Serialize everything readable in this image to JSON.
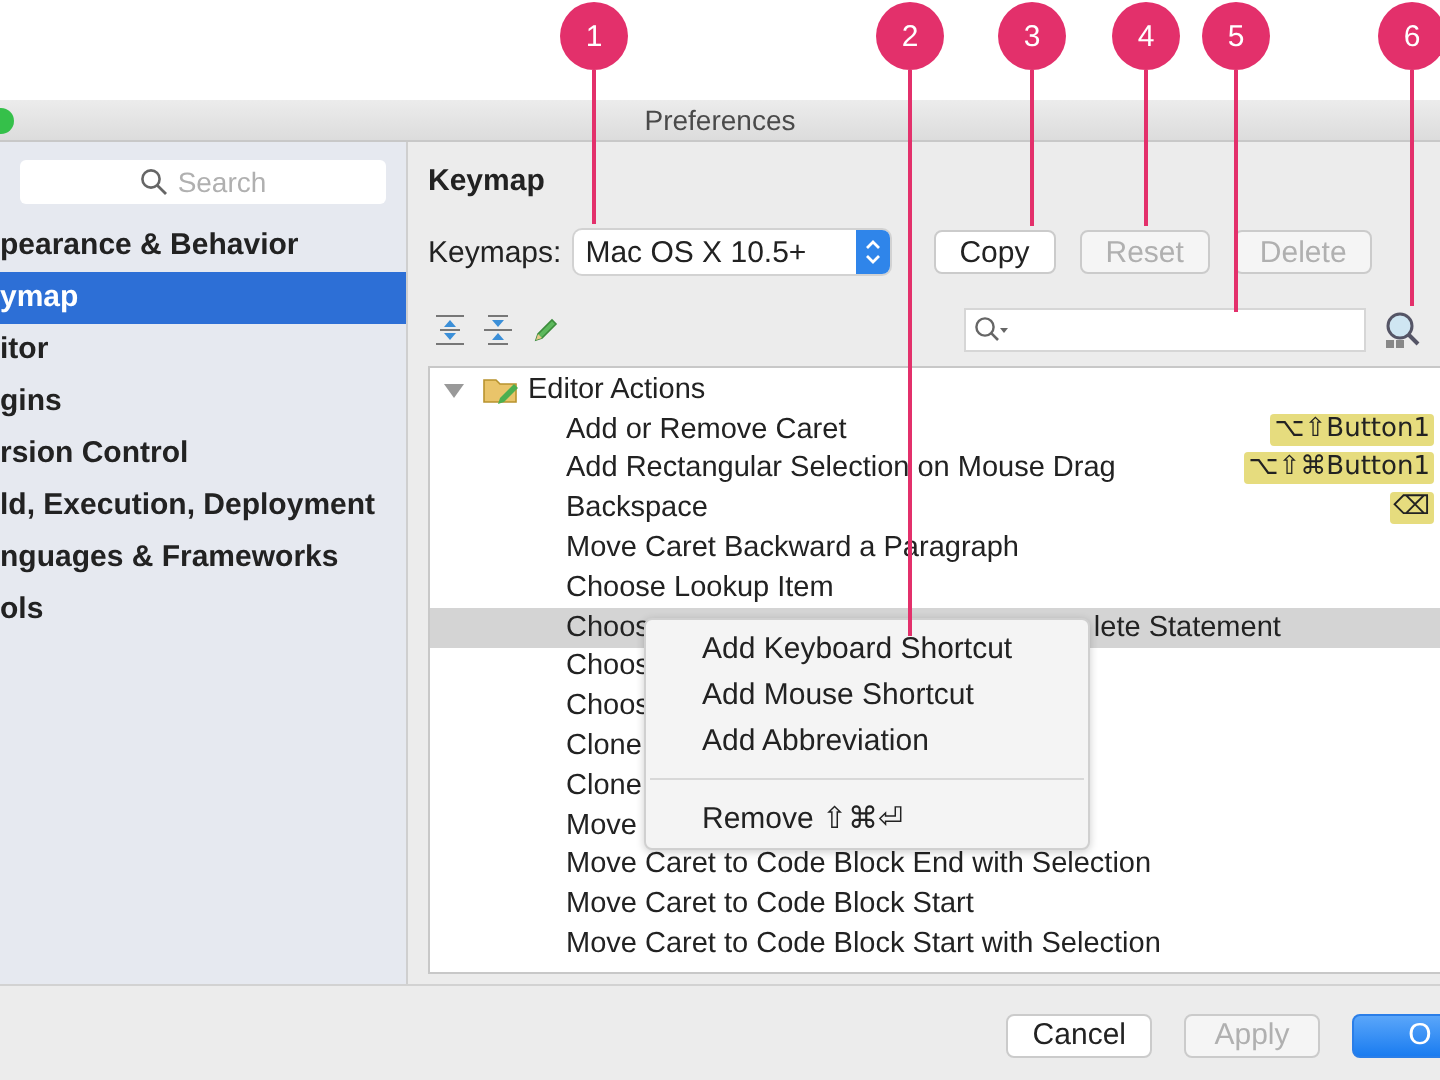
{
  "callouts": [
    {
      "number": "1"
    },
    {
      "number": "2"
    },
    {
      "number": "3"
    },
    {
      "number": "4"
    },
    {
      "number": "5"
    },
    {
      "number": "6"
    }
  ],
  "window": {
    "title": "Preferences"
  },
  "sidebar": {
    "search": {
      "placeholder": "Search"
    },
    "items": [
      {
        "label": "pearance & Behavior",
        "selected": false
      },
      {
        "label": "ymap",
        "selected": true
      },
      {
        "label": "itor",
        "selected": false
      },
      {
        "label": "gins",
        "selected": false
      },
      {
        "label": "rsion Control",
        "selected": false
      },
      {
        "label": "ld, Execution, Deployment",
        "selected": false
      },
      {
        "label": "nguages & Frameworks",
        "selected": false
      },
      {
        "label": "ols",
        "selected": false
      }
    ]
  },
  "panel": {
    "title": "Keymap",
    "keymaps_label": "Keymaps:",
    "keymap_select": {
      "value": "Mac OS X 10.5+"
    },
    "buttons": [
      {
        "label": "Copy",
        "disabled": false
      },
      {
        "label": "Reset",
        "disabled": true
      },
      {
        "label": "Delete",
        "disabled": true
      }
    ]
  },
  "tree": {
    "group": {
      "label": "Editor Actions",
      "expanded": true,
      "children": [
        {
          "parts": [
            "Add or Remove Caret"
          ],
          "shortcut": "⌥⇧Button1",
          "selected": false
        },
        {
          "parts": [
            "Add Rectangular Selection on Mouse Drag"
          ],
          "shortcut": "⌥⇧⌘Button1",
          "selected": false
        },
        {
          "parts": [
            "Backspace"
          ],
          "shortcut": "⌫",
          "selected": false
        },
        {
          "parts": [
            "Move Caret Backward a Paragraph"
          ],
          "selected": false
        },
        {
          "parts": [
            "Choose Lookup Item"
          ],
          "selected": false
        },
        {
          "parts": [
            "Choos",
            "lete Statement"
          ],
          "selected": true
        },
        {
          "parts": [
            "Choos"
          ],
          "selected": false
        },
        {
          "parts": [
            "Choos"
          ],
          "selected": false
        },
        {
          "parts": [
            "Clone"
          ],
          "selected": false
        },
        {
          "parts": [
            "Clone"
          ],
          "selected": false
        },
        {
          "parts": [
            "Move"
          ],
          "selected": false
        },
        {
          "parts": [
            "Move Caret to Code Block End with Selection"
          ],
          "selected": false
        },
        {
          "parts": [
            "Move Caret to Code Block Start"
          ],
          "selected": false
        },
        {
          "parts": [
            "Move Caret to Code Block Start with Selection"
          ],
          "selected": false
        }
      ]
    }
  },
  "context_menu": {
    "items": [
      {
        "kind": "item",
        "label": "Add Keyboard Shortcut"
      },
      {
        "kind": "item",
        "label": "Add Mouse Shortcut"
      },
      {
        "kind": "item",
        "label": "Add Abbreviation"
      },
      {
        "kind": "separator"
      },
      {
        "kind": "item",
        "label": "Remove",
        "shortcut": "⇧⌘⏎"
      }
    ]
  },
  "footer": {
    "buttons": [
      {
        "label": "Cancel",
        "disabled": false,
        "default": false
      },
      {
        "label": "Apply",
        "disabled": true,
        "default": false
      },
      {
        "label": "O",
        "disabled": false,
        "default": true
      }
    ]
  }
}
